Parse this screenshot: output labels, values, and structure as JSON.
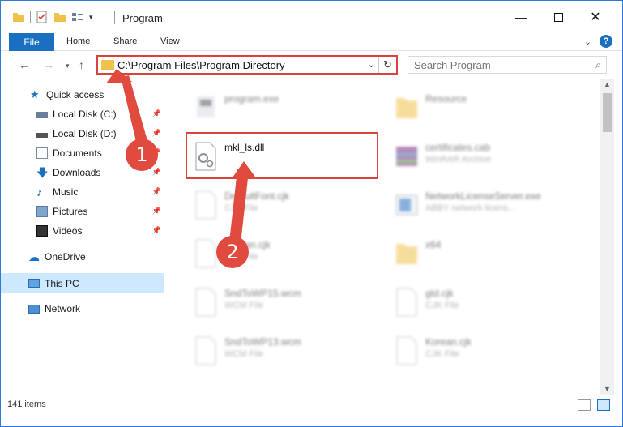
{
  "window": {
    "title": "Program"
  },
  "ribbon": {
    "file": "File",
    "home": "Home",
    "share": "Share",
    "view": "View",
    "help": "?"
  },
  "address": {
    "path": "C:\\Program Files\\Program Directory"
  },
  "search": {
    "placeholder": "Search Program"
  },
  "sidebar": {
    "items": [
      {
        "label": "Quick access",
        "icon": "star-icon"
      },
      {
        "label": "Local Disk (C:)",
        "icon": "drive-icon"
      },
      {
        "label": "Local Disk (D:)",
        "icon": "drive-icon"
      },
      {
        "label": "Documents",
        "icon": "document-icon"
      },
      {
        "label": "Downloads",
        "icon": "download-icon"
      },
      {
        "label": "Music",
        "icon": "music-icon"
      },
      {
        "label": "Pictures",
        "icon": "pictures-icon"
      },
      {
        "label": "Videos",
        "icon": "video-icon"
      },
      {
        "label": "OneDrive",
        "icon": "cloud-icon"
      },
      {
        "label": "This PC",
        "icon": "computer-icon"
      },
      {
        "label": "Network",
        "icon": "network-icon"
      }
    ]
  },
  "files": [
    {
      "name": "program.exe",
      "sub": ""
    },
    {
      "name": "Resource",
      "sub": ""
    },
    {
      "name": "mkl_ls.dll",
      "sub": ""
    },
    {
      "name": "certificates.cab",
      "sub": "WinRAR Archive"
    },
    {
      "name": "DefaultFont.cjk",
      "sub": "CJK File"
    },
    {
      "name": "NetworkLicenseServer.exe",
      "sub": "ABBY network licens..."
    },
    {
      "name": "Korean.cjk",
      "sub": "CJK File"
    },
    {
      "name": "x64",
      "sub": ""
    },
    {
      "name": "SndToWP15.wcm",
      "sub": "WCM File"
    },
    {
      "name": "gtd.cjk",
      "sub": "CJK File"
    },
    {
      "name": "SndToWP13.wcm",
      "sub": "WCM File"
    },
    {
      "name": "Korean.cjk",
      "sub": "CJK File"
    }
  ],
  "status": {
    "count": "141 items"
  },
  "annotations": {
    "one": "1",
    "two": "2"
  },
  "colors": {
    "accent": "#1a6fc1",
    "highlight": "#d9433e",
    "selection": "#cde8ff"
  }
}
